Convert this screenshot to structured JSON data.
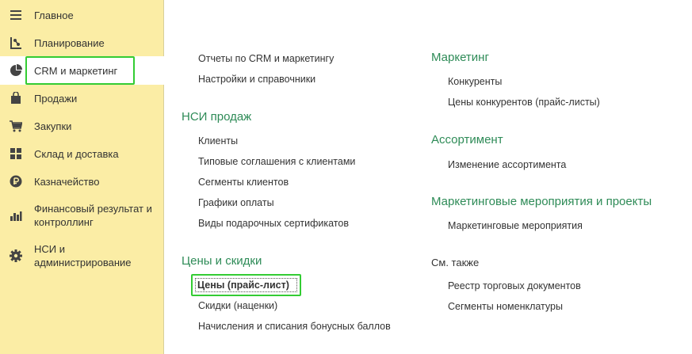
{
  "sidebar": {
    "items": [
      {
        "label": "Главное",
        "icon": "menu-icon"
      },
      {
        "label": "Планирование",
        "icon": "planning-icon"
      },
      {
        "label": "CRM и маркетинг",
        "icon": "pie-chart-icon"
      },
      {
        "label": "Продажи",
        "icon": "shopping-bag-icon"
      },
      {
        "label": "Закупки",
        "icon": "cart-icon"
      },
      {
        "label": "Склад и доставка",
        "icon": "warehouse-grid-icon"
      },
      {
        "label": "Казначейство",
        "icon": "ruble-coin-icon"
      },
      {
        "label": "Финансовый результат и контроллинг",
        "line1": "Финансовый результат и",
        "line2": "контроллинг",
        "icon": "bar-chart-icon"
      },
      {
        "label": "НСИ и администрирование",
        "line1": "НСИ и",
        "line2": "администрирование",
        "icon": "gear-icon"
      }
    ],
    "active_index": 2
  },
  "content": {
    "left": {
      "top_links": [
        "Отчеты по CRM и маркетингу",
        "Настройки и справочники"
      ],
      "groups": [
        {
          "title": "НСИ продаж",
          "links": [
            "Клиенты",
            "Типовые соглашения с клиентами",
            "Сегменты клиентов",
            "Графики оплаты",
            "Виды подарочных сертификатов"
          ]
        },
        {
          "title": "Цены и скидки",
          "links": [
            "Цены (прайс-лист)",
            "Скидки (наценки)",
            "Начисления и списания бонусных баллов"
          ]
        }
      ]
    },
    "right": {
      "groups": [
        {
          "title": "Маркетинг",
          "links": [
            "Конкуренты",
            "Цены конкурентов (прайс-листы)"
          ]
        },
        {
          "title": "Ассортимент",
          "links": [
            "Изменение ассортимента"
          ]
        },
        {
          "title": "Маркетинговые мероприятия и проекты",
          "links": [
            "Маркетинговые мероприятия"
          ]
        }
      ],
      "see_also": {
        "title": "См. также",
        "links": [
          "Реестр торговых документов",
          "Сегменты номенклатуры"
        ]
      }
    }
  },
  "colors": {
    "sidebar_bg": "#fbeda5",
    "group_title": "#2e8b57",
    "highlight": "#33cc33"
  }
}
